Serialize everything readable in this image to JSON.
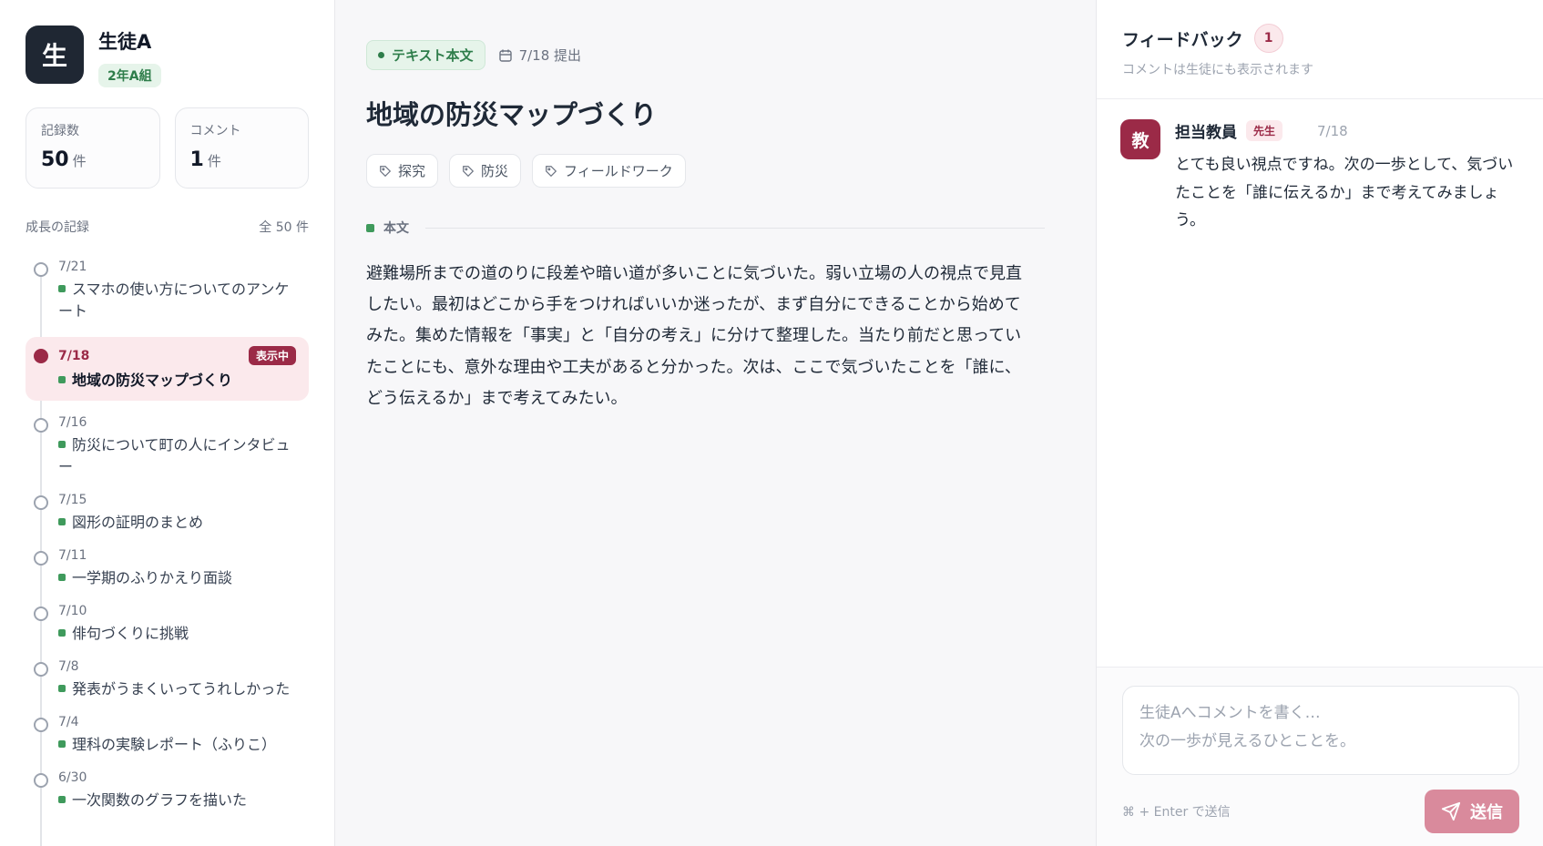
{
  "student": {
    "avatar_char": "生",
    "name": "生徒A",
    "class": "2年A組"
  },
  "stats": {
    "records_label": "記録数",
    "records_value": "50",
    "records_unit": "件",
    "comments_label": "コメント",
    "comments_value": "1",
    "comments_unit": "件"
  },
  "timeline": {
    "heading": "成長の記録",
    "total": "全 50 件",
    "now_badge": "表示中",
    "items": [
      {
        "date": "7/21",
        "title": "スマホの使い方についてのアンケート"
      },
      {
        "date": "7/18",
        "title": "地域の防災マップづくり"
      },
      {
        "date": "7/16",
        "title": "防災について町の人にインタビュー"
      },
      {
        "date": "7/15",
        "title": "図形の証明のまとめ"
      },
      {
        "date": "7/11",
        "title": "一学期のふりかえり面談"
      },
      {
        "date": "7/10",
        "title": "俳句づくりに挑戦"
      },
      {
        "date": "7/8",
        "title": "発表がうまくいってうれしかった"
      },
      {
        "date": "7/4",
        "title": "理科の実験レポート（ふりこ）"
      },
      {
        "date": "6/30",
        "title": "一次関数のグラフを描いた"
      }
    ]
  },
  "entry": {
    "type_label": "テキスト本文",
    "submitted": "7/18 提出",
    "title": "地域の防災マップづくり",
    "tags": [
      "探究",
      "防災",
      "フィールドワーク"
    ],
    "section_label": "本文",
    "body": "避難場所までの道のりに段差や暗い道が多いことに気づいた。弱い立場の人の視点で見直したい。最初はどこから手をつければいいか迷ったが、まず自分にできることから始めてみた。集めた情報を「事実」と「自分の考え」に分けて整理した。当たり前だと思っていたことにも、意外な理由や工夫があると分かった。次は、ここで気づいたことを「誰に、どう伝えるか」まで考えてみたい。"
  },
  "feedback": {
    "title": "フィードバック",
    "count": "1",
    "subtitle": "コメントは生徒にも表示されます",
    "comments": [
      {
        "avatar_char": "教",
        "author": "担当教員",
        "role": "先生",
        "date": "7/18",
        "text": "とても良い視点ですね。次の一歩として、気づいたことを「誰に伝えるか」まで考えてみましょう。"
      }
    ],
    "composer_placeholder_line1": "生徒Aへコメントを書く…",
    "composer_placeholder_line2": "次の一歩が見えるひとことを。",
    "hint": "⌘ + Enter で送信",
    "send_label": "送信"
  },
  "colors": {
    "accent": "#9b2a47",
    "accent_soft": "#fbe9ec",
    "green": "#3f9a5c",
    "send_button": "#d98a9c"
  }
}
